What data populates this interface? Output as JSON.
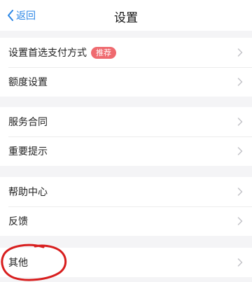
{
  "header": {
    "back_label": "返回",
    "title": "设置"
  },
  "groups": [
    {
      "items": [
        {
          "label": "设置首选支付方式",
          "badge": "推荐"
        },
        {
          "label": "额度设置"
        }
      ]
    },
    {
      "items": [
        {
          "label": "服务合同"
        },
        {
          "label": "重要提示"
        }
      ]
    },
    {
      "items": [
        {
          "label": "帮助中心"
        },
        {
          "label": "反馈"
        }
      ]
    },
    {
      "items": [
        {
          "label": "其他"
        }
      ]
    }
  ],
  "colors": {
    "accent": "#2a86e6",
    "badge": "#ef6a6f",
    "annotation": "#d81e1e",
    "background": "#f4f4f6"
  },
  "icons": {
    "back": "chevron-left-icon",
    "row_arrow": "chevron-right-icon"
  }
}
